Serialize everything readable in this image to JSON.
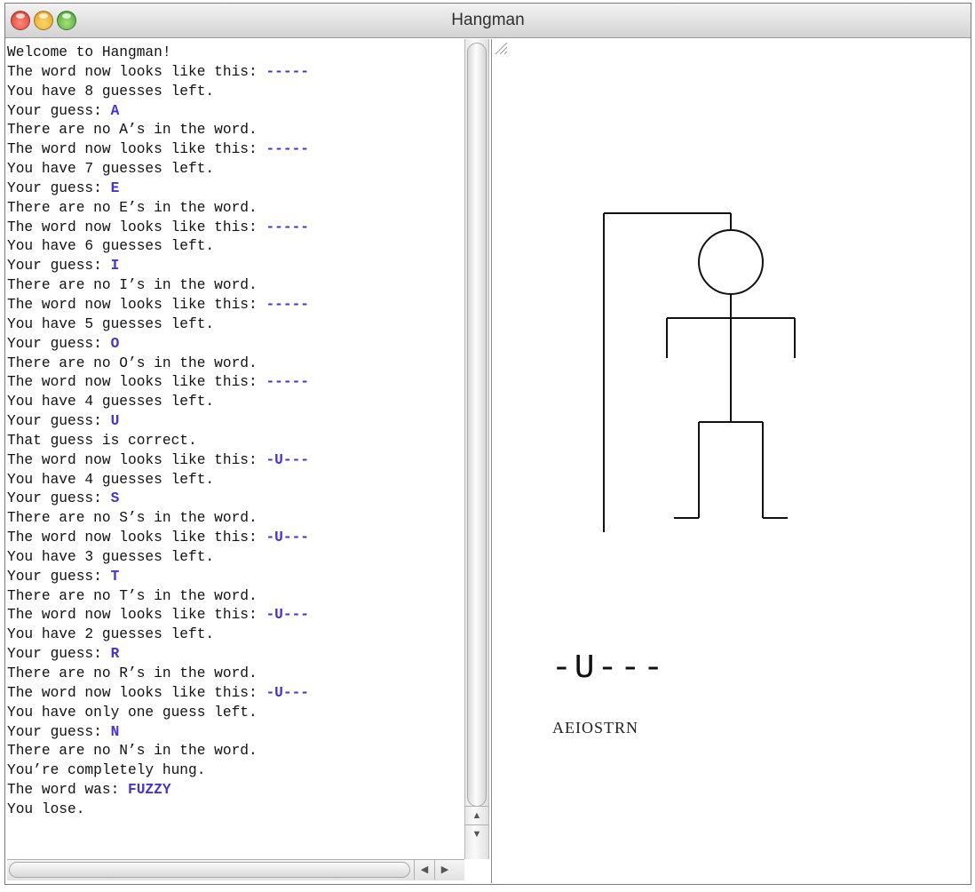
{
  "window": {
    "title": "Hangman",
    "buttons": [
      "close",
      "minimize",
      "zoom"
    ]
  },
  "console": [
    [
      [
        "Welcome to Hangman!",
        false
      ]
    ],
    [
      [
        "The word now looks like this: ",
        false
      ],
      [
        "-----",
        true
      ]
    ],
    [
      [
        "You have 8 guesses left.",
        false
      ]
    ],
    [
      [
        "Your guess: ",
        false
      ],
      [
        "A",
        true
      ]
    ],
    [
      [
        "There are no A’s in the word.",
        false
      ]
    ],
    [
      [
        "The word now looks like this: ",
        false
      ],
      [
        "-----",
        true
      ]
    ],
    [
      [
        "You have 7 guesses left.",
        false
      ]
    ],
    [
      [
        "Your guess: ",
        false
      ],
      [
        "E",
        true
      ]
    ],
    [
      [
        "There are no E’s in the word.",
        false
      ]
    ],
    [
      [
        "The word now looks like this: ",
        false
      ],
      [
        "-----",
        true
      ]
    ],
    [
      [
        "You have 6 guesses left.",
        false
      ]
    ],
    [
      [
        "Your guess: ",
        false
      ],
      [
        "I",
        true
      ]
    ],
    [
      [
        "There are no I’s in the word.",
        false
      ]
    ],
    [
      [
        "The word now looks like this: ",
        false
      ],
      [
        "-----",
        true
      ]
    ],
    [
      [
        "You have 5 guesses left.",
        false
      ]
    ],
    [
      [
        "Your guess: ",
        false
      ],
      [
        "O",
        true
      ]
    ],
    [
      [
        "There are no O’s in the word.",
        false
      ]
    ],
    [
      [
        "The word now looks like this: ",
        false
      ],
      [
        "-----",
        true
      ]
    ],
    [
      [
        "You have 4 guesses left.",
        false
      ]
    ],
    [
      [
        "Your guess: ",
        false
      ],
      [
        "U",
        true
      ]
    ],
    [
      [
        "That guess is correct.",
        false
      ]
    ],
    [
      [
        "The word now looks like this: ",
        false
      ],
      [
        "-U---",
        true
      ]
    ],
    [
      [
        "You have 4 guesses left.",
        false
      ]
    ],
    [
      [
        "Your guess: ",
        false
      ],
      [
        "S",
        true
      ]
    ],
    [
      [
        "There are no S’s in the word.",
        false
      ]
    ],
    [
      [
        "The word now looks like this: ",
        false
      ],
      [
        "-U---",
        true
      ]
    ],
    [
      [
        "You have 3 guesses left.",
        false
      ]
    ],
    [
      [
        "Your guess: ",
        false
      ],
      [
        "T",
        true
      ]
    ],
    [
      [
        "There are no T’s in the word.",
        false
      ]
    ],
    [
      [
        "The word now looks like this: ",
        false
      ],
      [
        "-U---",
        true
      ]
    ],
    [
      [
        "You have 2 guesses left.",
        false
      ]
    ],
    [
      [
        "Your guess: ",
        false
      ],
      [
        "R",
        true
      ]
    ],
    [
      [
        "There are no R’s in the word.",
        false
      ]
    ],
    [
      [
        "The word now looks like this: ",
        false
      ],
      [
        "-U---",
        true
      ]
    ],
    [
      [
        "You have only one guess left.",
        false
      ]
    ],
    [
      [
        "Your guess: ",
        false
      ],
      [
        "N",
        true
      ]
    ],
    [
      [
        "There are no N’s in the word.",
        false
      ]
    ],
    [
      [
        "You’re completely hung.",
        false
      ]
    ],
    [
      [
        "The word was: ",
        false
      ],
      [
        "FUZZY",
        true
      ]
    ],
    [
      [
        "You lose.",
        false
      ]
    ]
  ],
  "colors": {
    "user_input": "#4433dd",
    "text": "#111111"
  },
  "scrollbars": {
    "vertical": {
      "up_icon": "up-arrow-icon",
      "down_icon": "down-arrow-icon"
    },
    "horizontal": {
      "left_icon": "left-arrow-icon",
      "right_icon": "right-arrow-icon"
    }
  },
  "canvas": {
    "partial_word": "-U---",
    "incorrect_guesses": "AEIOSTRN"
  }
}
